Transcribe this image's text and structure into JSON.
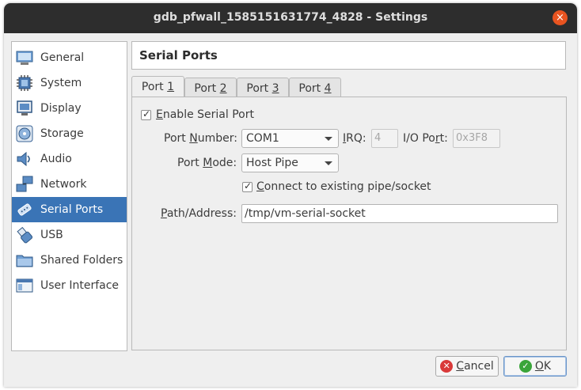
{
  "window": {
    "title": "gdb_pfwall_1585151631774_4828 - Settings",
    "close_glyph": "×"
  },
  "sidebar": {
    "items": [
      {
        "label": "General"
      },
      {
        "label": "System"
      },
      {
        "label": "Display"
      },
      {
        "label": "Storage"
      },
      {
        "label": "Audio"
      },
      {
        "label": "Network"
      },
      {
        "label": "Serial Ports",
        "active": true
      },
      {
        "label": "USB"
      },
      {
        "label": "Shared Folders"
      },
      {
        "label": "User Interface"
      }
    ]
  },
  "section": {
    "title": "Serial Ports"
  },
  "tabs": [
    {
      "prefix": "Port ",
      "key": "1",
      "active": true
    },
    {
      "prefix": "Port ",
      "key": "2"
    },
    {
      "prefix": "Port ",
      "key": "3"
    },
    {
      "prefix": "Port ",
      "key": "4"
    }
  ],
  "form": {
    "enable": {
      "pre": "",
      "key": "E",
      "post": "nable Serial Port",
      "checked": true
    },
    "port_number": {
      "pre": "Port ",
      "key": "N",
      "post": "umber:",
      "value": "COM1"
    },
    "irq": {
      "pre": "",
      "key": "I",
      "post": "RQ:",
      "value": "4"
    },
    "io_port": {
      "pre": "I/O Po",
      "key": "r",
      "post": "t:",
      "value": "0x3F8"
    },
    "port_mode": {
      "pre": "Port ",
      "key": "M",
      "post": "ode:",
      "value": "Host Pipe"
    },
    "connect": {
      "pre": "",
      "key": "C",
      "post": "onnect to existing pipe/socket",
      "checked": true
    },
    "path": {
      "pre": "",
      "key": "P",
      "post": "ath/Address:",
      "value": "/tmp/vm-serial-socket"
    }
  },
  "buttons": {
    "cancel": {
      "pre": "",
      "key": "C",
      "post": "ancel",
      "icon_glyph": "✕",
      "color": "#d93a3a"
    },
    "ok": {
      "pre": "",
      "key": "O",
      "post": "K",
      "icon_glyph": "✓",
      "color": "#3aa53a"
    }
  },
  "colors": {
    "accent": "#3a74b6",
    "title_bg": "#2d2d2d",
    "close": "#e95420"
  }
}
